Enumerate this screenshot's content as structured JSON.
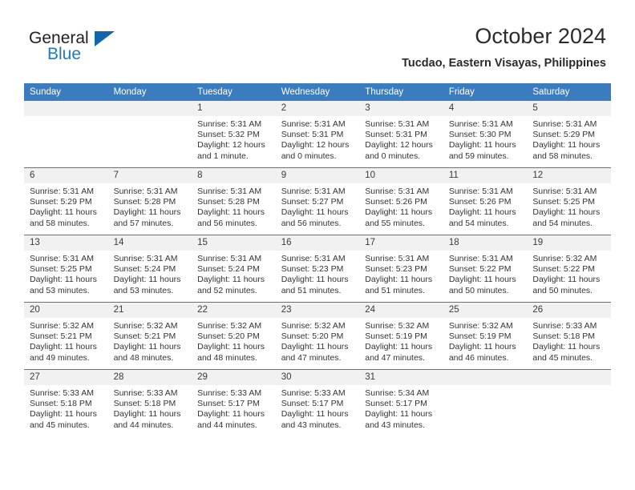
{
  "brand": {
    "name_part1": "General",
    "name_part2": "Blue",
    "triangle_icon": "triangle-icon",
    "accent_color": "#1065ab",
    "blue_text_color": "#1b7bc4"
  },
  "header": {
    "title": "October 2024",
    "subtitle": "Tucdao, Eastern Visayas, Philippines"
  },
  "calendar": {
    "header_bg": "#3a7cbe",
    "daynum_bg": "#f1f1f1",
    "weekday_headers": [
      "Sunday",
      "Monday",
      "Tuesday",
      "Wednesday",
      "Thursday",
      "Friday",
      "Saturday"
    ],
    "weeks": [
      [
        {
          "day": "",
          "empty": true,
          "sunrise": "",
          "sunset": "",
          "daylight_line1": "",
          "daylight_line2": ""
        },
        {
          "day": "",
          "empty": true,
          "sunrise": "",
          "sunset": "",
          "daylight_line1": "",
          "daylight_line2": ""
        },
        {
          "day": "1",
          "empty": false,
          "sunrise": "Sunrise: 5:31 AM",
          "sunset": "Sunset: 5:32 PM",
          "daylight_line1": "Daylight: 12 hours",
          "daylight_line2": "and 1 minute."
        },
        {
          "day": "2",
          "empty": false,
          "sunrise": "Sunrise: 5:31 AM",
          "sunset": "Sunset: 5:31 PM",
          "daylight_line1": "Daylight: 12 hours",
          "daylight_line2": "and 0 minutes."
        },
        {
          "day": "3",
          "empty": false,
          "sunrise": "Sunrise: 5:31 AM",
          "sunset": "Sunset: 5:31 PM",
          "daylight_line1": "Daylight: 12 hours",
          "daylight_line2": "and 0 minutes."
        },
        {
          "day": "4",
          "empty": false,
          "sunrise": "Sunrise: 5:31 AM",
          "sunset": "Sunset: 5:30 PM",
          "daylight_line1": "Daylight: 11 hours",
          "daylight_line2": "and 59 minutes."
        },
        {
          "day": "5",
          "empty": false,
          "sunrise": "Sunrise: 5:31 AM",
          "sunset": "Sunset: 5:29 PM",
          "daylight_line1": "Daylight: 11 hours",
          "daylight_line2": "and 58 minutes."
        }
      ],
      [
        {
          "day": "6",
          "empty": false,
          "sunrise": "Sunrise: 5:31 AM",
          "sunset": "Sunset: 5:29 PM",
          "daylight_line1": "Daylight: 11 hours",
          "daylight_line2": "and 58 minutes."
        },
        {
          "day": "7",
          "empty": false,
          "sunrise": "Sunrise: 5:31 AM",
          "sunset": "Sunset: 5:28 PM",
          "daylight_line1": "Daylight: 11 hours",
          "daylight_line2": "and 57 minutes."
        },
        {
          "day": "8",
          "empty": false,
          "sunrise": "Sunrise: 5:31 AM",
          "sunset": "Sunset: 5:28 PM",
          "daylight_line1": "Daylight: 11 hours",
          "daylight_line2": "and 56 minutes."
        },
        {
          "day": "9",
          "empty": false,
          "sunrise": "Sunrise: 5:31 AM",
          "sunset": "Sunset: 5:27 PM",
          "daylight_line1": "Daylight: 11 hours",
          "daylight_line2": "and 56 minutes."
        },
        {
          "day": "10",
          "empty": false,
          "sunrise": "Sunrise: 5:31 AM",
          "sunset": "Sunset: 5:26 PM",
          "daylight_line1": "Daylight: 11 hours",
          "daylight_line2": "and 55 minutes."
        },
        {
          "day": "11",
          "empty": false,
          "sunrise": "Sunrise: 5:31 AM",
          "sunset": "Sunset: 5:26 PM",
          "daylight_line1": "Daylight: 11 hours",
          "daylight_line2": "and 54 minutes."
        },
        {
          "day": "12",
          "empty": false,
          "sunrise": "Sunrise: 5:31 AM",
          "sunset": "Sunset: 5:25 PM",
          "daylight_line1": "Daylight: 11 hours",
          "daylight_line2": "and 54 minutes."
        }
      ],
      [
        {
          "day": "13",
          "empty": false,
          "sunrise": "Sunrise: 5:31 AM",
          "sunset": "Sunset: 5:25 PM",
          "daylight_line1": "Daylight: 11 hours",
          "daylight_line2": "and 53 minutes."
        },
        {
          "day": "14",
          "empty": false,
          "sunrise": "Sunrise: 5:31 AM",
          "sunset": "Sunset: 5:24 PM",
          "daylight_line1": "Daylight: 11 hours",
          "daylight_line2": "and 53 minutes."
        },
        {
          "day": "15",
          "empty": false,
          "sunrise": "Sunrise: 5:31 AM",
          "sunset": "Sunset: 5:24 PM",
          "daylight_line1": "Daylight: 11 hours",
          "daylight_line2": "and 52 minutes."
        },
        {
          "day": "16",
          "empty": false,
          "sunrise": "Sunrise: 5:31 AM",
          "sunset": "Sunset: 5:23 PM",
          "daylight_line1": "Daylight: 11 hours",
          "daylight_line2": "and 51 minutes."
        },
        {
          "day": "17",
          "empty": false,
          "sunrise": "Sunrise: 5:31 AM",
          "sunset": "Sunset: 5:23 PM",
          "daylight_line1": "Daylight: 11 hours",
          "daylight_line2": "and 51 minutes."
        },
        {
          "day": "18",
          "empty": false,
          "sunrise": "Sunrise: 5:31 AM",
          "sunset": "Sunset: 5:22 PM",
          "daylight_line1": "Daylight: 11 hours",
          "daylight_line2": "and 50 minutes."
        },
        {
          "day": "19",
          "empty": false,
          "sunrise": "Sunrise: 5:32 AM",
          "sunset": "Sunset: 5:22 PM",
          "daylight_line1": "Daylight: 11 hours",
          "daylight_line2": "and 50 minutes."
        }
      ],
      [
        {
          "day": "20",
          "empty": false,
          "sunrise": "Sunrise: 5:32 AM",
          "sunset": "Sunset: 5:21 PM",
          "daylight_line1": "Daylight: 11 hours",
          "daylight_line2": "and 49 minutes."
        },
        {
          "day": "21",
          "empty": false,
          "sunrise": "Sunrise: 5:32 AM",
          "sunset": "Sunset: 5:21 PM",
          "daylight_line1": "Daylight: 11 hours",
          "daylight_line2": "and 48 minutes."
        },
        {
          "day": "22",
          "empty": false,
          "sunrise": "Sunrise: 5:32 AM",
          "sunset": "Sunset: 5:20 PM",
          "daylight_line1": "Daylight: 11 hours",
          "daylight_line2": "and 48 minutes."
        },
        {
          "day": "23",
          "empty": false,
          "sunrise": "Sunrise: 5:32 AM",
          "sunset": "Sunset: 5:20 PM",
          "daylight_line1": "Daylight: 11 hours",
          "daylight_line2": "and 47 minutes."
        },
        {
          "day": "24",
          "empty": false,
          "sunrise": "Sunrise: 5:32 AM",
          "sunset": "Sunset: 5:19 PM",
          "daylight_line1": "Daylight: 11 hours",
          "daylight_line2": "and 47 minutes."
        },
        {
          "day": "25",
          "empty": false,
          "sunrise": "Sunrise: 5:32 AM",
          "sunset": "Sunset: 5:19 PM",
          "daylight_line1": "Daylight: 11 hours",
          "daylight_line2": "and 46 minutes."
        },
        {
          "day": "26",
          "empty": false,
          "sunrise": "Sunrise: 5:33 AM",
          "sunset": "Sunset: 5:18 PM",
          "daylight_line1": "Daylight: 11 hours",
          "daylight_line2": "and 45 minutes."
        }
      ],
      [
        {
          "day": "27",
          "empty": false,
          "sunrise": "Sunrise: 5:33 AM",
          "sunset": "Sunset: 5:18 PM",
          "daylight_line1": "Daylight: 11 hours",
          "daylight_line2": "and 45 minutes."
        },
        {
          "day": "28",
          "empty": false,
          "sunrise": "Sunrise: 5:33 AM",
          "sunset": "Sunset: 5:18 PM",
          "daylight_line1": "Daylight: 11 hours",
          "daylight_line2": "and 44 minutes."
        },
        {
          "day": "29",
          "empty": false,
          "sunrise": "Sunrise: 5:33 AM",
          "sunset": "Sunset: 5:17 PM",
          "daylight_line1": "Daylight: 11 hours",
          "daylight_line2": "and 44 minutes."
        },
        {
          "day": "30",
          "empty": false,
          "sunrise": "Sunrise: 5:33 AM",
          "sunset": "Sunset: 5:17 PM",
          "daylight_line1": "Daylight: 11 hours",
          "daylight_line2": "and 43 minutes."
        },
        {
          "day": "31",
          "empty": false,
          "sunrise": "Sunrise: 5:34 AM",
          "sunset": "Sunset: 5:17 PM",
          "daylight_line1": "Daylight: 11 hours",
          "daylight_line2": "and 43 minutes."
        },
        {
          "day": "",
          "empty": true,
          "sunrise": "",
          "sunset": "",
          "daylight_line1": "",
          "daylight_line2": ""
        },
        {
          "day": "",
          "empty": true,
          "sunrise": "",
          "sunset": "",
          "daylight_line1": "",
          "daylight_line2": ""
        }
      ]
    ]
  }
}
